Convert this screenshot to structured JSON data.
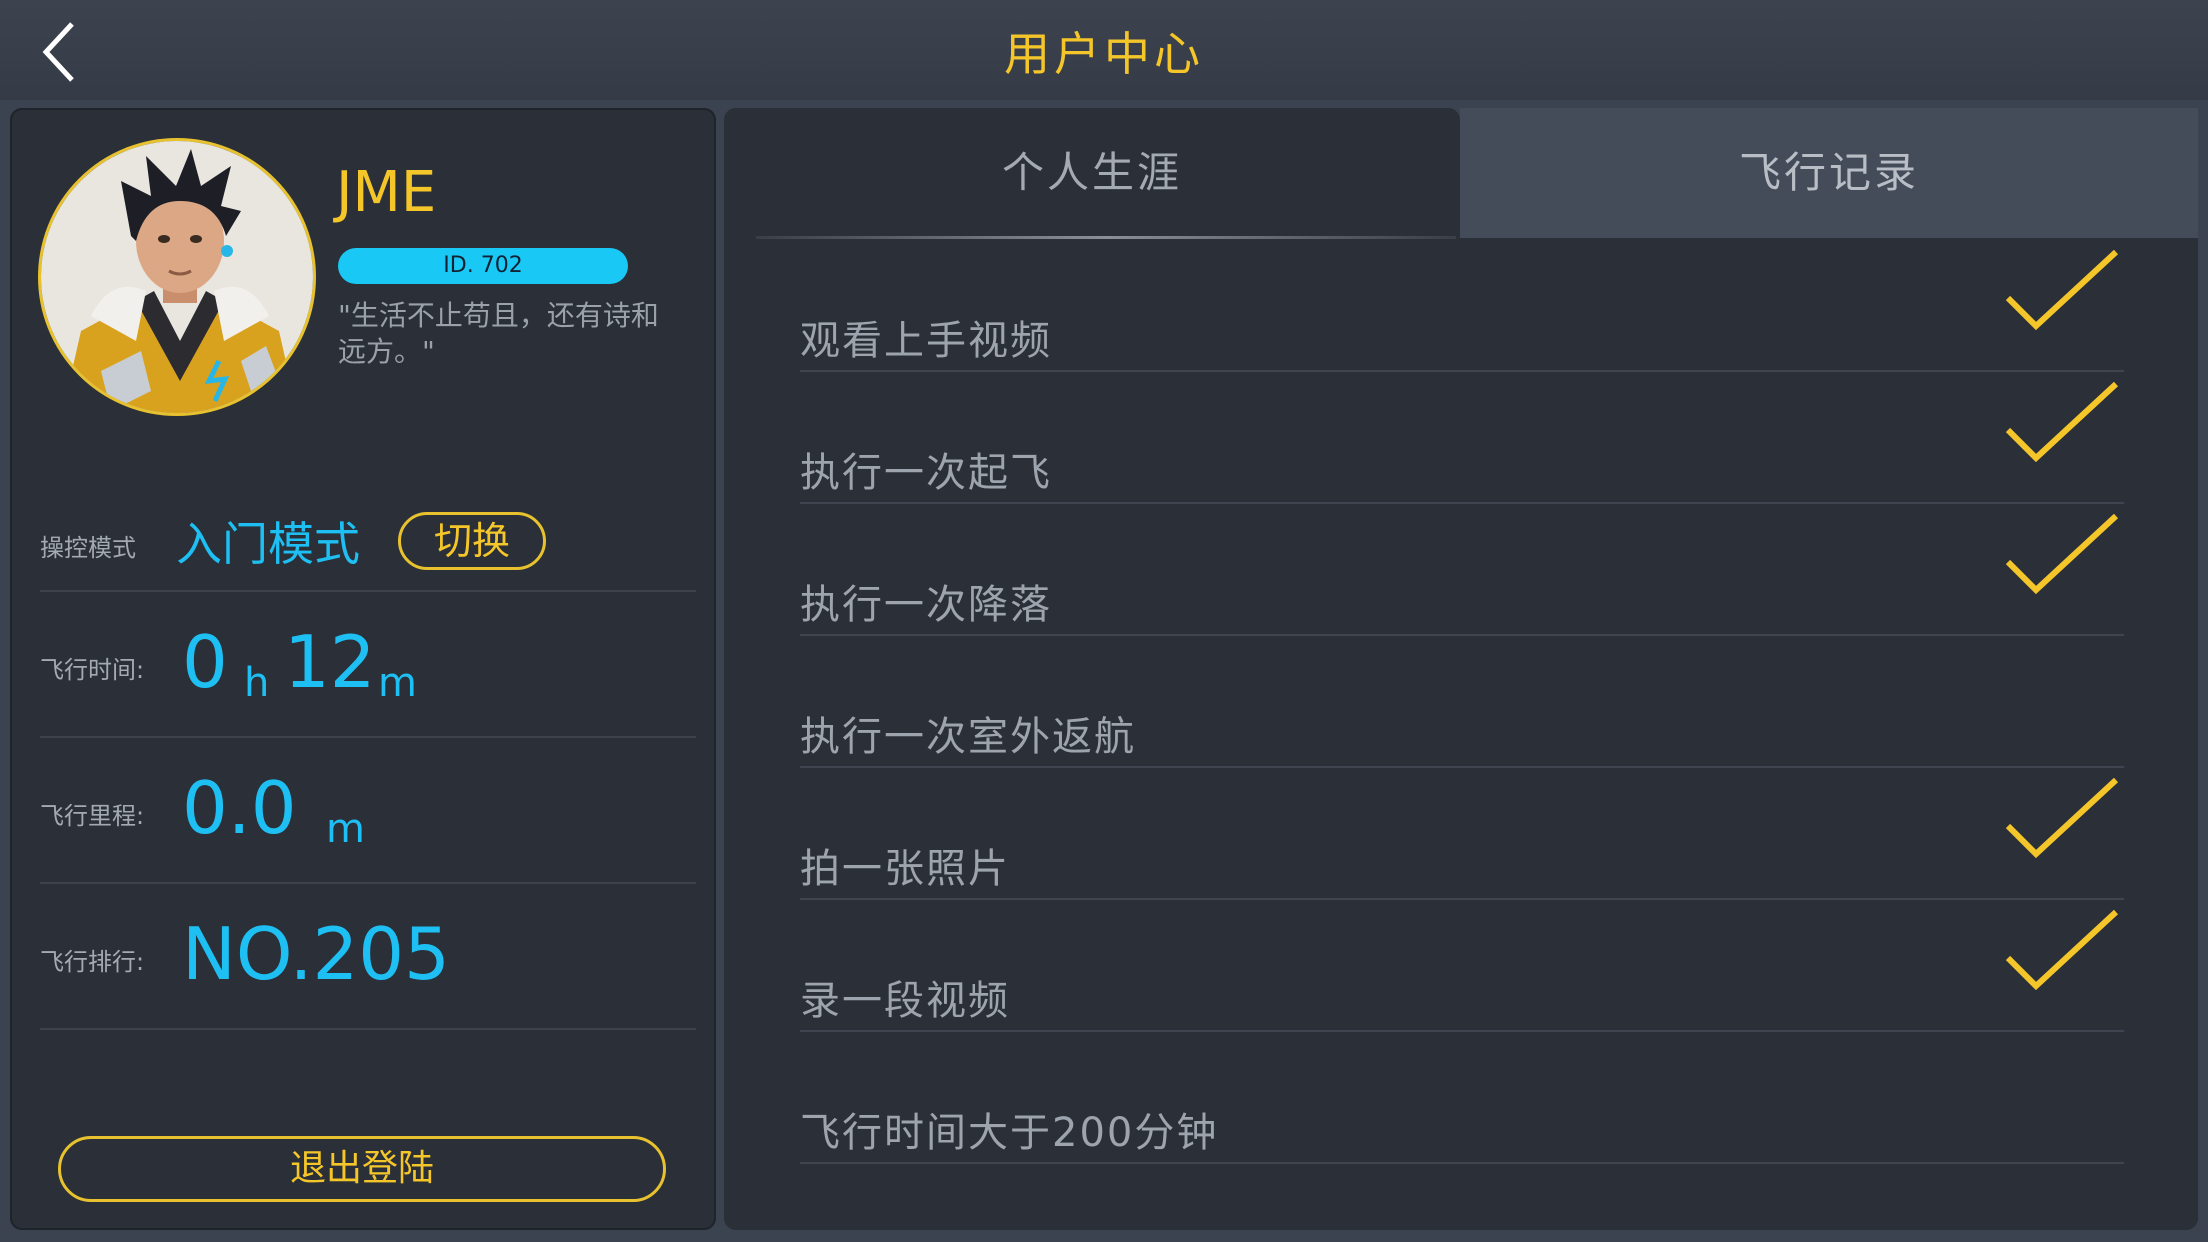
{
  "header": {
    "title": "用户中心",
    "back_icon": "chevron-left-icon"
  },
  "profile": {
    "name": "JME",
    "id_label": "ID. 702",
    "motto": "\"生活不止苟且，还有诗和远方。\"",
    "control_mode_label": "操控模式",
    "control_mode_value": "入门模式",
    "switch_label": "切换",
    "flight_time_label": "飞行时间:",
    "flight_time_hours": "0",
    "flight_time_h_unit": "h",
    "flight_time_minutes": "12",
    "flight_time_m_unit": "m",
    "flight_distance_label": "飞行里程:",
    "flight_distance_value": "0.0",
    "flight_distance_unit": "m",
    "flight_rank_label": "飞行排行:",
    "flight_rank_value": "NO.205",
    "logout_label": "退出登陆"
  },
  "tabs": [
    {
      "label": "个人生涯",
      "active": true
    },
    {
      "label": "飞行记录",
      "active": false
    }
  ],
  "tasks": [
    {
      "label": "观看上手视频",
      "done": true
    },
    {
      "label": "执行一次起飞",
      "done": true
    },
    {
      "label": "执行一次降落",
      "done": true
    },
    {
      "label": "执行一次室外返航",
      "done": false
    },
    {
      "label": "拍一张照片",
      "done": true
    },
    {
      "label": "录一段视频",
      "done": true
    },
    {
      "label": "飞行时间大于200分钟",
      "done": false
    }
  ],
  "colors": {
    "accent_yellow": "#f5c62a",
    "accent_cyan": "#1ec0f4",
    "panel": "#2a2f38"
  }
}
